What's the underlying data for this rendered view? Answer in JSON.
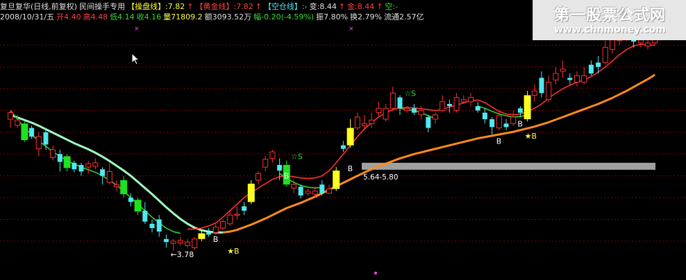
{
  "header": {
    "line1": [
      {
        "text": "复旦复华(日线,前复权)",
        "color": "white"
      },
      {
        "text": "民间操手专用",
        "color": "white"
      },
      {
        "text": "【操盘线】:7.82",
        "color": "yellow"
      },
      {
        "text": "↑",
        "color": "red"
      },
      {
        "text": "【黄金线】:7.82",
        "color": "red"
      },
      {
        "text": "↑",
        "color": "red"
      },
      {
        "text": "【空仓线】:-",
        "color": "cyan"
      },
      {
        "text": "变:8.44",
        "color": "white"
      },
      {
        "text": "↑",
        "color": "red"
      },
      {
        "text": "金:8.44",
        "color": "red"
      },
      {
        "text": "↑",
        "color": "red"
      },
      {
        "text": "空:-",
        "color": "green"
      }
    ],
    "line2": [
      {
        "text": "2008/10/31/五",
        "color": "white"
      },
      {
        "text": "开4.40",
        "color": "red"
      },
      {
        "text": "高4.48",
        "color": "red"
      },
      {
        "text": "低4.14",
        "color": "green"
      },
      {
        "text": "收4.16",
        "color": "green"
      },
      {
        "text": "量71809.2",
        "color": "yellow"
      },
      {
        "text": "额3093.52万",
        "color": "white"
      },
      {
        "text": "幅-0.20(-4.59%)",
        "color": "green"
      },
      {
        "text": "振7.80%",
        "color": "white"
      },
      {
        "text": "换2.79%",
        "color": "white"
      },
      {
        "text": "流通2.57亿",
        "color": "white"
      }
    ]
  },
  "watermark": {
    "title": "第一股票公式网",
    "url": "www.chnmoney.com"
  },
  "colors": {
    "background": "#000000",
    "grid": "#8b0000",
    "up_candle": "#ff3030",
    "down_candle": "#50e8f0",
    "green_bar": "#20e020",
    "yellow_bar": "#ffff20",
    "fast_line": "#ff3030",
    "green_line": "#30d030",
    "slow_line": "#ff8c1a",
    "slow_line_early": "#a0ffc0",
    "band": "#a0a0a0"
  },
  "chart_data": {
    "type": "candlestick",
    "ylim": [
      3.3,
      8.9
    ],
    "candles": [
      {
        "o": 6.8,
        "c": 6.95,
        "h": 7.0,
        "l": 6.6,
        "k": "up"
      },
      {
        "o": 6.78,
        "c": 6.66,
        "h": 6.9,
        "l": 6.6,
        "k": "up"
      },
      {
        "o": 6.7,
        "c": 6.32,
        "h": 6.75,
        "l": 6.28,
        "k": "green"
      },
      {
        "o": 6.6,
        "c": 6.4,
        "h": 6.65,
        "l": 6.35,
        "k": "down"
      },
      {
        "o": 6.4,
        "c": 6.12,
        "h": 6.5,
        "l": 5.95,
        "k": "up"
      },
      {
        "o": 6.5,
        "c": 6.22,
        "h": 6.6,
        "l": 6.1,
        "k": "down"
      },
      {
        "o": 6.1,
        "c": 5.92,
        "h": 6.2,
        "l": 5.85,
        "k": "up"
      },
      {
        "o": 6.0,
        "c": 5.82,
        "h": 6.1,
        "l": 5.6,
        "k": "down"
      },
      {
        "o": 5.95,
        "c": 5.68,
        "h": 6.0,
        "l": 5.6,
        "k": "green"
      },
      {
        "o": 5.8,
        "c": 5.65,
        "h": 5.85,
        "l": 5.58,
        "k": "down"
      },
      {
        "o": 5.75,
        "c": 5.6,
        "h": 5.8,
        "l": 5.5,
        "k": "down"
      },
      {
        "o": 5.7,
        "c": 5.78,
        "h": 5.85,
        "l": 5.55,
        "k": "up"
      },
      {
        "o": 5.8,
        "c": 5.72,
        "h": 5.9,
        "l": 5.65,
        "k": "up"
      },
      {
        "o": 5.65,
        "c": 5.5,
        "h": 5.7,
        "l": 5.3,
        "k": "down"
      },
      {
        "o": 5.6,
        "c": 5.35,
        "h": 5.8,
        "l": 5.3,
        "k": "up"
      },
      {
        "o": 5.3,
        "c": 5.25,
        "h": 5.4,
        "l": 5.15,
        "k": "up"
      },
      {
        "o": 5.4,
        "c": 5.08,
        "h": 5.5,
        "l": 5.0,
        "k": "green"
      },
      {
        "o": 5.0,
        "c": 4.9,
        "h": 5.1,
        "l": 4.8,
        "k": "down"
      },
      {
        "o": 4.95,
        "c": 4.68,
        "h": 5.0,
        "l": 4.6,
        "k": "green"
      },
      {
        "o": 4.7,
        "c": 4.45,
        "h": 4.9,
        "l": 4.4,
        "k": "down"
      },
      {
        "o": 4.4,
        "c": 4.3,
        "h": 4.5,
        "l": 4.2,
        "k": "down"
      },
      {
        "o": 4.5,
        "c": 4.22,
        "h": 4.6,
        "l": 4.1,
        "k": "down"
      },
      {
        "o": 4.05,
        "c": 3.98,
        "h": 4.15,
        "l": 3.85,
        "k": "down"
      },
      {
        "o": 4.0,
        "c": 3.95,
        "h": 4.05,
        "l": 3.78,
        "k": "up"
      },
      {
        "o": 3.96,
        "c": 4.02,
        "h": 4.1,
        "l": 3.9,
        "k": "up"
      },
      {
        "o": 3.98,
        "c": 3.9,
        "h": 4.05,
        "l": 3.85,
        "k": "up"
      },
      {
        "o": 3.85,
        "c": 4.05,
        "h": 4.1,
        "l": 3.8,
        "k": "up"
      },
      {
        "o": 4.05,
        "c": 4.18,
        "h": 4.25,
        "l": 4.0,
        "k": "yellow"
      },
      {
        "o": 4.15,
        "c": 4.2,
        "h": 4.3,
        "l": 4.1,
        "k": "down"
      },
      {
        "o": 4.2,
        "c": 4.32,
        "h": 4.4,
        "l": 4.15,
        "k": "up"
      },
      {
        "o": 4.3,
        "c": 4.45,
        "h": 4.5,
        "l": 4.25,
        "k": "up"
      },
      {
        "o": 4.4,
        "c": 4.6,
        "h": 4.7,
        "l": 4.35,
        "k": "up"
      },
      {
        "o": 4.6,
        "c": 4.62,
        "h": 4.8,
        "l": 4.5,
        "k": "up"
      },
      {
        "o": 4.7,
        "c": 4.8,
        "h": 4.9,
        "l": 4.6,
        "k": "down"
      },
      {
        "o": 4.9,
        "c": 5.32,
        "h": 5.4,
        "l": 4.85,
        "k": "yellow"
      },
      {
        "o": 5.4,
        "c": 5.55,
        "h": 5.6,
        "l": 5.3,
        "k": "up"
      },
      {
        "o": 5.7,
        "c": 5.88,
        "h": 5.95,
        "l": 5.6,
        "k": "up"
      },
      {
        "o": 5.9,
        "c": 6.05,
        "h": 6.1,
        "l": 5.8,
        "k": "up"
      },
      {
        "o": 5.75,
        "c": 5.62,
        "h": 5.9,
        "l": 5.4,
        "k": "down"
      },
      {
        "o": 5.75,
        "c": 5.3,
        "h": 5.85,
        "l": 5.25,
        "k": "green"
      },
      {
        "o": 5.3,
        "c": 5.22,
        "h": 5.4,
        "l": 5.1,
        "k": "up"
      },
      {
        "o": 5.25,
        "c": 5.05,
        "h": 5.3,
        "l": 4.98,
        "k": "down"
      },
      {
        "o": 5.1,
        "c": 5.15,
        "h": 5.2,
        "l": 5.05,
        "k": "up"
      },
      {
        "o": 5.15,
        "c": 5.08,
        "h": 5.25,
        "l": 5.0,
        "k": "up"
      },
      {
        "o": 5.3,
        "c": 5.1,
        "h": 5.4,
        "l": 5.05,
        "k": "down"
      },
      {
        "o": 5.1,
        "c": 5.2,
        "h": 5.3,
        "l": 5.08,
        "k": "up"
      },
      {
        "o": 5.2,
        "c": 5.62,
        "h": 5.7,
        "l": 5.15,
        "k": "yellow"
      },
      {
        "o": 6.2,
        "c": 6.12,
        "h": 6.3,
        "l": 6.05,
        "k": "down"
      },
      {
        "o": 6.2,
        "c": 6.6,
        "h": 6.8,
        "l": 6.15,
        "k": "yellow"
      },
      {
        "o": 6.6,
        "c": 6.85,
        "h": 6.95,
        "l": 6.55,
        "k": "up"
      },
      {
        "o": 6.7,
        "c": 6.65,
        "h": 6.9,
        "l": 6.55,
        "k": "up"
      },
      {
        "o": 6.7,
        "c": 6.78,
        "h": 6.95,
        "l": 6.6,
        "k": "up"
      },
      {
        "o": 6.95,
        "c": 7.05,
        "h": 7.2,
        "l": 6.85,
        "k": "up"
      },
      {
        "o": 6.8,
        "c": 7.05,
        "h": 7.15,
        "l": 6.75,
        "k": "up"
      },
      {
        "o": 7.05,
        "c": 7.4,
        "h": 7.55,
        "l": 7.0,
        "k": "up"
      },
      {
        "o": 7.3,
        "c": 7.05,
        "h": 7.35,
        "l": 6.9,
        "k": "down"
      },
      {
        "o": 7.0,
        "c": 7.05,
        "h": 7.1,
        "l": 6.95,
        "k": "up"
      },
      {
        "o": 7.05,
        "c": 6.95,
        "h": 7.15,
        "l": 6.9,
        "k": "down"
      },
      {
        "o": 6.9,
        "c": 7.0,
        "h": 7.1,
        "l": 6.8,
        "k": "up"
      },
      {
        "o": 6.85,
        "c": 6.6,
        "h": 6.9,
        "l": 6.5,
        "k": "down"
      },
      {
        "o": 6.8,
        "c": 6.9,
        "h": 6.95,
        "l": 6.7,
        "k": "up"
      },
      {
        "o": 7.0,
        "c": 7.2,
        "h": 7.35,
        "l": 6.95,
        "k": "up"
      },
      {
        "o": 7.15,
        "c": 7.1,
        "h": 7.25,
        "l": 6.95,
        "k": "down"
      },
      {
        "o": 7.0,
        "c": 7.3,
        "h": 7.4,
        "l": 6.95,
        "k": "up"
      },
      {
        "o": 7.25,
        "c": 7.2,
        "h": 7.35,
        "l": 7.15,
        "k": "up"
      },
      {
        "o": 7.2,
        "c": 7.3,
        "h": 7.4,
        "l": 7.1,
        "k": "up"
      },
      {
        "o": 7.1,
        "c": 7.0,
        "h": 7.2,
        "l": 6.95,
        "k": "down"
      },
      {
        "o": 6.95,
        "c": 6.8,
        "h": 7.05,
        "l": 6.7,
        "k": "down"
      },
      {
        "o": 6.8,
        "c": 6.62,
        "h": 6.85,
        "l": 6.45,
        "k": "down"
      },
      {
        "o": 6.6,
        "c": 6.88,
        "h": 7.0,
        "l": 6.55,
        "k": "up"
      },
      {
        "o": 6.7,
        "c": 6.62,
        "h": 6.8,
        "l": 6.55,
        "k": "down"
      },
      {
        "o": 6.7,
        "c": 6.85,
        "h": 7.0,
        "l": 6.65,
        "k": "up"
      },
      {
        "o": 7.05,
        "c": 6.95,
        "h": 7.1,
        "l": 6.85,
        "k": "down"
      },
      {
        "o": 6.8,
        "c": 7.35,
        "h": 7.45,
        "l": 6.75,
        "k": "yellow"
      },
      {
        "o": 7.35,
        "c": 7.45,
        "h": 7.6,
        "l": 7.2,
        "k": "up"
      },
      {
        "o": 7.4,
        "c": 7.75,
        "h": 7.9,
        "l": 7.3,
        "k": "down"
      },
      {
        "o": 7.65,
        "c": 7.25,
        "h": 7.8,
        "l": 7.2,
        "k": "up"
      },
      {
        "o": 7.7,
        "c": 7.85,
        "h": 8.0,
        "l": 7.6,
        "k": "up"
      },
      {
        "o": 7.9,
        "c": 7.95,
        "h": 8.15,
        "l": 7.75,
        "k": "up"
      },
      {
        "o": 7.75,
        "c": 7.7,
        "h": 7.85,
        "l": 7.6,
        "k": "down"
      },
      {
        "o": 7.8,
        "c": 7.65,
        "h": 7.9,
        "l": 7.55,
        "k": "up"
      },
      {
        "o": 7.65,
        "c": 7.8,
        "h": 8.0,
        "l": 7.6,
        "k": "up"
      },
      {
        "o": 7.85,
        "c": 8.05,
        "h": 8.15,
        "l": 7.8,
        "k": "down"
      },
      {
        "o": 8.0,
        "c": 8.1,
        "h": 8.25,
        "l": 7.85,
        "k": "down"
      },
      {
        "o": 8.1,
        "c": 8.45,
        "h": 8.6,
        "l": 8.05,
        "k": "up"
      },
      {
        "o": 8.4,
        "c": 8.62,
        "h": 8.75,
        "l": 8.3,
        "k": "up"
      },
      {
        "o": 8.6,
        "c": 8.7,
        "h": 8.8,
        "l": 8.5,
        "k": "up"
      },
      {
        "o": 8.7,
        "c": 8.78,
        "h": 8.85,
        "l": 8.6,
        "k": "up"
      },
      {
        "o": 8.65,
        "c": 8.58,
        "h": 8.72,
        "l": 8.45,
        "k": "down"
      },
      {
        "o": 8.55,
        "c": 8.62,
        "h": 8.7,
        "l": 8.45,
        "k": "up"
      },
      {
        "o": 8.48,
        "c": 8.55,
        "h": 8.62,
        "l": 8.4,
        "k": "up"
      },
      {
        "o": 8.55,
        "c": 8.7,
        "h": 8.8,
        "l": 8.5,
        "k": "up"
      }
    ],
    "lines": {
      "slow": [
        6.9,
        6.84,
        6.78,
        6.72,
        6.65,
        6.57,
        6.49,
        6.41,
        6.33,
        6.25,
        6.18,
        6.11,
        6.03,
        5.94,
        5.84,
        5.73,
        5.62,
        5.5,
        5.36,
        5.22,
        5.08,
        4.93,
        4.78,
        4.64,
        4.51,
        4.4,
        4.31,
        4.25,
        4.22,
        4.2,
        4.2,
        4.22,
        4.26,
        4.32,
        4.38,
        4.45,
        4.52,
        4.6,
        4.68,
        4.76,
        4.82,
        4.88,
        4.95,
        5.02,
        5.1,
        5.18,
        5.26,
        5.34,
        5.42,
        5.5,
        5.58,
        5.65,
        5.72,
        5.78,
        5.84,
        5.9,
        5.95,
        6.0,
        6.04,
        6.08,
        6.12,
        6.16,
        6.2,
        6.24,
        6.28,
        6.32,
        6.36,
        6.39,
        6.42,
        6.45,
        6.48,
        6.51,
        6.55,
        6.59,
        6.63,
        6.68,
        6.73,
        6.79,
        6.85,
        6.91,
        6.97,
        7.03,
        7.09,
        7.15,
        7.22,
        7.29,
        7.37,
        7.45,
        7.54,
        7.63,
        7.72,
        7.82
      ],
      "fast": [
        null,
        null,
        null,
        null,
        null,
        null,
        null,
        null,
        null,
        null,
        null,
        null,
        null,
        null,
        null,
        null,
        null,
        null,
        null,
        null,
        null,
        null,
        null,
        null,
        null,
        4.28,
        4.28,
        4.3,
        4.35,
        4.42,
        4.55,
        4.7,
        4.85,
        5.0,
        5.12,
        5.22,
        5.32,
        5.42,
        5.48,
        5.5,
        5.48,
        5.45,
        5.44,
        5.45,
        5.5,
        5.62,
        5.8,
        6.0,
        6.2,
        6.4,
        6.58,
        6.72,
        6.85,
        6.95,
        7.02,
        7.06,
        7.07,
        7.06,
        7.04,
        7.02,
        7.0,
        7.02,
        7.08,
        7.12,
        7.18,
        7.22,
        7.24,
        7.18,
        7.08,
        6.98,
        6.92,
        6.9,
        6.92,
        6.98,
        7.05,
        7.15,
        7.28,
        7.4,
        7.5,
        7.58,
        7.65,
        7.7,
        7.78,
        7.88,
        8.0,
        8.14,
        8.28,
        8.4,
        8.48,
        8.52,
        8.5,
        8.5
      ],
      "green": [
        7.0,
        6.8,
        6.6,
        6.45,
        6.3,
        6.18,
        6.05,
        5.95,
        5.85,
        5.77,
        5.7,
        5.64,
        5.58,
        5.5,
        5.4,
        5.28,
        5.15,
        5.0,
        4.85,
        4.7,
        4.55,
        4.42,
        4.3,
        4.22,
        4.18,
        null,
        null,
        null,
        null,
        null,
        null,
        null,
        null,
        null,
        null,
        null,
        null,
        null,
        5.55,
        5.45,
        5.35,
        5.28,
        5.24,
        5.22,
        5.24,
        null,
        null,
        null,
        null,
        null,
        null,
        null,
        null,
        null,
        null,
        7.05,
        7.02,
        7.0,
        6.95,
        6.88,
        6.82,
        null,
        null,
        null,
        null,
        null,
        7.1,
        7.05,
        6.98,
        6.92,
        6.88,
        6.85,
        6.86,
        6.9,
        null,
        null,
        null,
        null,
        null,
        null,
        null,
        null,
        null,
        null,
        null,
        null,
        null,
        null,
        null,
        null,
        null,
        null
      ]
    },
    "band": {
      "label": "5.64-5.80",
      "low": 5.64,
      "high": 5.8,
      "from_index": 50
    },
    "annotations": [
      {
        "text": "←3.78",
        "index": 23,
        "price": 3.7,
        "color": "white"
      },
      {
        "text": "★B",
        "index": 31,
        "price": 3.78,
        "color": "yellow"
      },
      {
        "text": "B",
        "index": 29,
        "price": 4.05,
        "color": "white"
      },
      {
        "text": "☆S",
        "index": 40,
        "price": 5.95,
        "color": "green"
      },
      {
        "text": "B",
        "index": 39,
        "price": 5.5,
        "color": "white"
      },
      {
        "text": "B",
        "index": 48,
        "price": 5.67,
        "color": "white"
      },
      {
        "text": "☆S",
        "index": 56,
        "price": 7.4,
        "color": "green"
      },
      {
        "text": "B",
        "index": 69,
        "price": 6.3,
        "color": "white"
      },
      {
        "text": "B",
        "index": 72,
        "price": 6.7,
        "color": "white"
      },
      {
        "text": "★B",
        "index": 73,
        "price": 6.42,
        "color": "yellow"
      }
    ],
    "gridlines": [
      4.0,
      4.5,
      5.0,
      5.5,
      6.0,
      6.5,
      7.0,
      7.5,
      8.0,
      8.5
    ]
  }
}
